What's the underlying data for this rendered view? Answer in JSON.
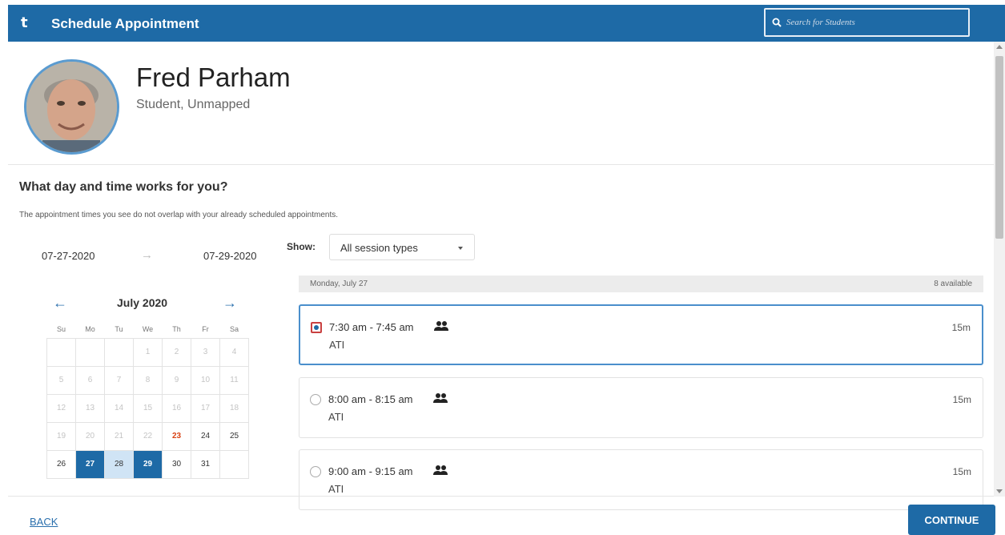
{
  "header": {
    "logo": "t",
    "title": "Schedule Appointment",
    "search_placeholder": "Search for Students"
  },
  "profile": {
    "name": "Fred Parham",
    "role": "Student, Unmapped"
  },
  "prompt": {
    "question": "What day and time works for you?",
    "note": "The appointment times you see do not overlap with your already scheduled appointments."
  },
  "date_range": {
    "start": "07-27-2020",
    "end": "07-29-2020"
  },
  "calendar": {
    "month": "July 2020",
    "weekdays": [
      "Su",
      "Mo",
      "Tu",
      "We",
      "Th",
      "Fr",
      "Sa"
    ],
    "weeks": [
      [
        "",
        "",
        "",
        "1",
        "2",
        "3",
        "4"
      ],
      [
        "5",
        "6",
        "7",
        "8",
        "9",
        "10",
        "11"
      ],
      [
        "12",
        "13",
        "14",
        "15",
        "16",
        "17",
        "18"
      ],
      [
        "19",
        "20",
        "21",
        "22",
        "23",
        "24",
        "25"
      ],
      [
        "26",
        "27",
        "28",
        "29",
        "30",
        "31",
        ""
      ]
    ],
    "today": "23",
    "selected": [
      "27",
      "29"
    ],
    "in_range": [
      "28"
    ]
  },
  "filter": {
    "label": "Show:",
    "selected": "All session types"
  },
  "day": {
    "label": "Monday, July 27",
    "count": "8 available"
  },
  "slots": [
    {
      "time": "7:30 am - 7:45 am",
      "location": "ATI",
      "duration": "15m",
      "selected": true
    },
    {
      "time": "8:00 am - 8:15 am",
      "location": "ATI",
      "duration": "15m",
      "selected": false
    },
    {
      "time": "9:00 am - 9:15 am",
      "location": "ATI",
      "duration": "15m",
      "selected": false
    }
  ],
  "footer": {
    "back": "BACK",
    "continue": "CONTINUE"
  },
  "colors": {
    "brand": "#1e6aa6",
    "today": "#d84315",
    "range": "#d0e4f5"
  },
  "icons": {
    "search": "search-icon",
    "group": "group-icon",
    "prev": "arrow-left-icon",
    "next": "arrow-right-icon"
  }
}
